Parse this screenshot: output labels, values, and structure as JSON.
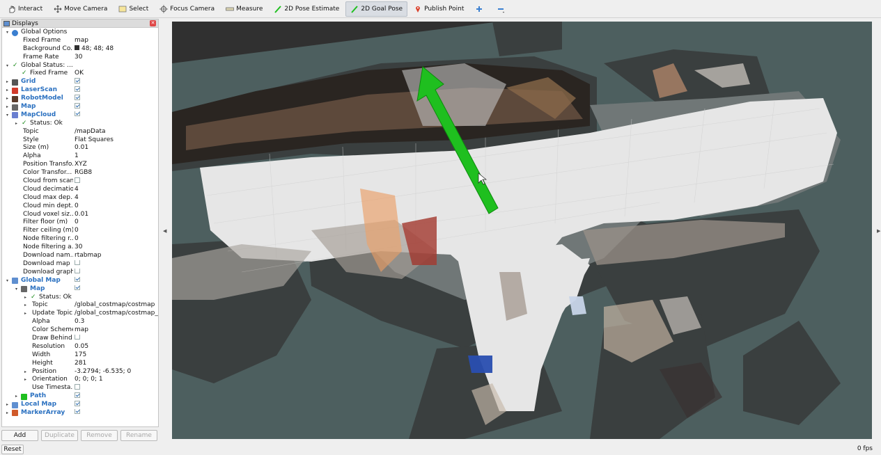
{
  "toolbar": {
    "interact": "Interact",
    "move_camera": "Move Camera",
    "select": "Select",
    "focus_camera": "Focus Camera",
    "measure": "Measure",
    "pose_estimate": "2D Pose Estimate",
    "goal_pose": "2D Goal Pose",
    "publish_point": "Publish Point"
  },
  "displays": {
    "title": "Displays",
    "rows": [
      {
        "name": "Global Options",
        "value": ""
      },
      {
        "name": "Fixed Frame",
        "value": "map"
      },
      {
        "name": "Background Co...",
        "value": "48; 48; 48"
      },
      {
        "name": "Frame Rate",
        "value": "30"
      },
      {
        "name": "Global Status: ...",
        "value": ""
      },
      {
        "name": "Fixed Frame",
        "value": "OK"
      },
      {
        "name": "Grid",
        "value": ""
      },
      {
        "name": "LaserScan",
        "value": ""
      },
      {
        "name": "RobotModel",
        "value": ""
      },
      {
        "name": "Map",
        "value": ""
      },
      {
        "name": "MapCloud",
        "value": ""
      },
      {
        "name": "Status: Ok",
        "value": ""
      },
      {
        "name": "Topic",
        "value": "/mapData"
      },
      {
        "name": "Style",
        "value": "Flat Squares"
      },
      {
        "name": "Size (m)",
        "value": "0.01"
      },
      {
        "name": "Alpha",
        "value": "1"
      },
      {
        "name": "Position Transfo...",
        "value": "XYZ"
      },
      {
        "name": "Color Transfor...",
        "value": "RGB8"
      },
      {
        "name": "Cloud from scan",
        "value": ""
      },
      {
        "name": "Cloud decimation",
        "value": "4"
      },
      {
        "name": "Cloud max dep...",
        "value": "4"
      },
      {
        "name": "Cloud min dept...",
        "value": "0"
      },
      {
        "name": "Cloud voxel siz...",
        "value": "0.01"
      },
      {
        "name": "Filter floor (m)",
        "value": "0"
      },
      {
        "name": "Filter ceiling (m)",
        "value": "0"
      },
      {
        "name": "Node filtering r...",
        "value": "0"
      },
      {
        "name": "Node filtering a...",
        "value": "30"
      },
      {
        "name": "Download nam...",
        "value": "rtabmap"
      },
      {
        "name": "Download map",
        "value": ""
      },
      {
        "name": "Download graph",
        "value": ""
      },
      {
        "name": "Global Map",
        "value": ""
      },
      {
        "name": "Map",
        "value": ""
      },
      {
        "name": "Status: Ok",
        "value": ""
      },
      {
        "name": "Topic",
        "value": "/global_costmap/costmap"
      },
      {
        "name": "Update Topic",
        "value": "/global_costmap/costmap_u..."
      },
      {
        "name": "Alpha",
        "value": "0.3"
      },
      {
        "name": "Color Scheme",
        "value": "map"
      },
      {
        "name": "Draw Behind",
        "value": ""
      },
      {
        "name": "Resolution",
        "value": "0.05"
      },
      {
        "name": "Width",
        "value": "175"
      },
      {
        "name": "Height",
        "value": "281"
      },
      {
        "name": "Position",
        "value": "-3.2794; -6.535; 0"
      },
      {
        "name": "Orientation",
        "value": "0; 0; 0; 1"
      },
      {
        "name": "Use Timesta...",
        "value": ""
      },
      {
        "name": "Path",
        "value": ""
      },
      {
        "name": "Local Map",
        "value": ""
      },
      {
        "name": "MarkerArray",
        "value": ""
      }
    ]
  },
  "buttons": {
    "add": "Add",
    "duplicate": "Duplicate",
    "remove": "Remove",
    "rename": "Rename",
    "reset": "Reset"
  },
  "status": {
    "fps": "0 fps"
  },
  "colors": {
    "background": "#303030",
    "free_space": "#e8e8e8",
    "unknown": "#4d5f5f",
    "goal_arrow": "#1fbf1f",
    "link_blue": "#2a70c0"
  }
}
